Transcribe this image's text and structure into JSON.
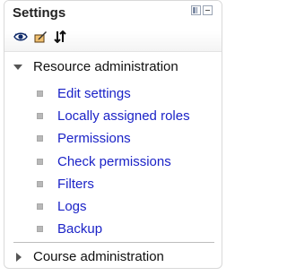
{
  "block": {
    "title": "Settings",
    "header_icons": [
      "dock-icon",
      "collapse-minus-icon"
    ],
    "toolbar_icons": [
      "eye-icon",
      "edit-icon",
      "move-icon"
    ]
  },
  "resource_admin": {
    "label": "Resource administration",
    "expanded": true,
    "items": [
      {
        "label": "Edit settings"
      },
      {
        "label": "Locally assigned roles"
      },
      {
        "label": "Permissions"
      },
      {
        "label": "Check permissions"
      },
      {
        "label": "Filters"
      },
      {
        "label": "Logs"
      },
      {
        "label": "Backup"
      }
    ]
  },
  "course_admin": {
    "label": "Course administration",
    "expanded": false
  },
  "colors": {
    "link": "#1b23c7",
    "text": "#111111",
    "border": "#d9d9d9"
  }
}
